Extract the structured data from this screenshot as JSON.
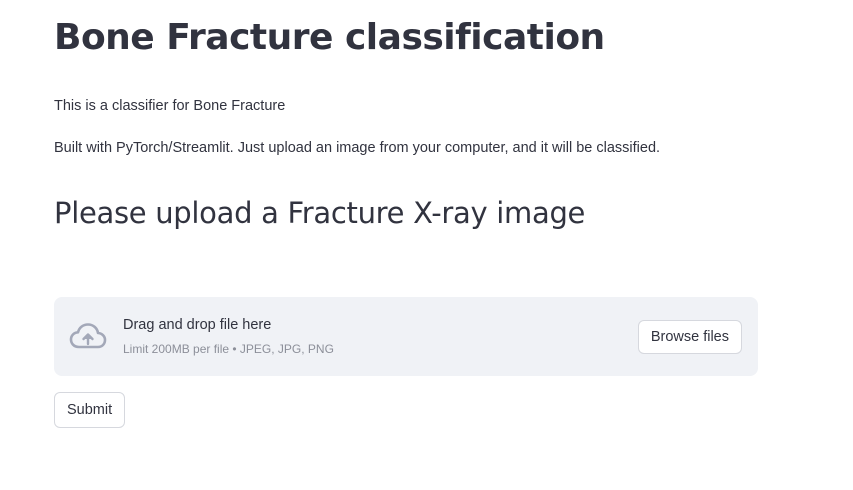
{
  "header": {
    "title": "Bone Fracture classification"
  },
  "intro": {
    "line1": "This is a classifier for Bone Fracture",
    "line2": "Built with PyTorch/Streamlit. Just upload an image from your computer, and it will be classified."
  },
  "upload_section": {
    "heading": "Please upload a Fracture X-ray image"
  },
  "file_uploader": {
    "icon": "cloud-upload-icon",
    "title": "Drag and drop file here",
    "limit_text": "Limit 200MB per file • JPEG, JPG, PNG",
    "browse_label": "Browse files",
    "background": "#f0f2f6",
    "icon_color": "#a3a8b8"
  },
  "actions": {
    "submit_label": "Submit"
  }
}
